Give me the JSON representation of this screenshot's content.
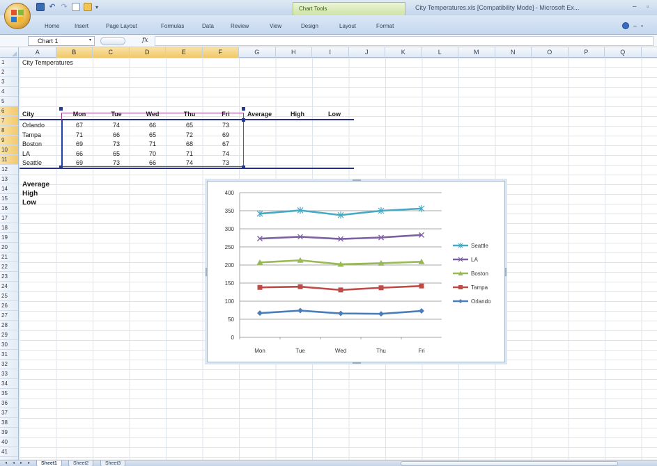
{
  "window": {
    "title": "City Temperatures.xls  [Compatibility Mode] - Microsoft Ex...",
    "contextual_tab_title": "Chart Tools",
    "minimize_glyph": "–",
    "restore_glyph": "▫"
  },
  "quick_access": {
    "more_glyph": "▾",
    "undo_glyph": "↶",
    "redo_glyph": "↷"
  },
  "ribbon": {
    "tabs": [
      "Home",
      "Insert",
      "Page Layout",
      "Formulas",
      "Data",
      "Review",
      "View",
      "Design",
      "Layout",
      "Format"
    ],
    "help_min_glyph": "–",
    "help_close_glyph": "▫"
  },
  "formula_bar": {
    "name_box": "Chart 1",
    "dropdown_glyph": "▾",
    "fx_label": "fx",
    "formula": ""
  },
  "columns": [
    "A",
    "B",
    "C",
    "D",
    "E",
    "F",
    "G",
    "H",
    "I",
    "J",
    "K",
    "L",
    "M",
    "N",
    "O",
    "P",
    "Q"
  ],
  "selected_columns": [
    "B",
    "C",
    "D",
    "E",
    "F"
  ],
  "rows": [
    "1",
    "2",
    "3",
    "4",
    "5",
    "6",
    "7",
    "8",
    "9",
    "10",
    "11",
    "12",
    "13",
    "14",
    "15",
    "16",
    "17",
    "18",
    "19",
    "20",
    "21",
    "22",
    "23",
    "24",
    "25",
    "26",
    "27",
    "28",
    "29",
    "30",
    "31",
    "32",
    "33",
    "34",
    "35",
    "36",
    "37",
    "38",
    "39",
    "40",
    "41"
  ],
  "sheet": {
    "title_cell": "City Temperatures",
    "header": {
      "city": "City",
      "days": [
        "Mon",
        "Tue",
        "Wed",
        "Thu",
        "Fri"
      ],
      "stats": [
        "Average",
        "High",
        "Low"
      ]
    },
    "table": [
      {
        "city": "Orlando",
        "values": [
          67,
          74,
          66,
          65,
          73
        ]
      },
      {
        "city": "Tampa",
        "values": [
          71,
          66,
          65,
          72,
          69
        ]
      },
      {
        "city": "Boston",
        "values": [
          69,
          73,
          71,
          68,
          67
        ]
      },
      {
        "city": "LA",
        "values": [
          66,
          65,
          70,
          71,
          74
        ]
      },
      {
        "city": "Seattle",
        "values": [
          69,
          73,
          66,
          74,
          73
        ]
      }
    ],
    "summary_labels": [
      "Average",
      "High",
      "Low"
    ]
  },
  "chart_data": {
    "type": "line",
    "stacked": true,
    "categories": [
      "Mon",
      "Tue",
      "Wed",
      "Thu",
      "Fri"
    ],
    "ylim": [
      0,
      400
    ],
    "yticks": [
      "0",
      "50",
      "100",
      "150",
      "200",
      "250",
      "300",
      "350",
      "400"
    ],
    "grid": true,
    "legend_position": "right",
    "series": [
      {
        "name": "Orlando",
        "values": [
          67,
          74,
          66,
          65,
          73
        ],
        "color": "#4a7ebb"
      },
      {
        "name": "Tampa",
        "values": [
          71,
          66,
          65,
          72,
          69
        ],
        "color": "#be4b48"
      },
      {
        "name": "Boston",
        "values": [
          69,
          73,
          71,
          68,
          67
        ],
        "color": "#98b954"
      },
      {
        "name": "LA",
        "values": [
          66,
          65,
          70,
          71,
          74
        ],
        "color": "#7d60a0"
      },
      {
        "name": "Seattle",
        "values": [
          69,
          73,
          66,
          74,
          73
        ],
        "color": "#46aac5"
      }
    ]
  },
  "sheet_tabs": [
    "Sheet1",
    "Sheet2",
    "Sheet3"
  ],
  "active_sheet": "Sheet1",
  "sheet_nav_glyphs": [
    "◂",
    "◂",
    "▸",
    "▸"
  ]
}
